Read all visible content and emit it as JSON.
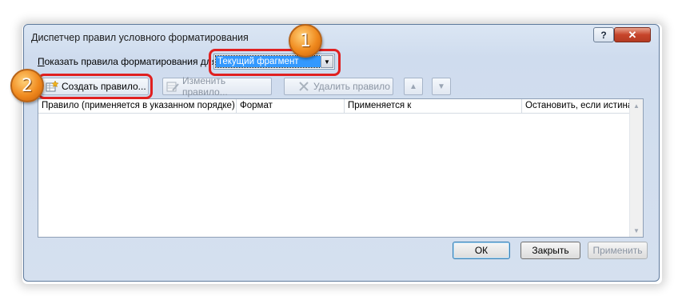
{
  "window": {
    "title": "Диспетчер правил условного форматирования",
    "help_label": "?",
    "close_label": "✕"
  },
  "show_rules": {
    "label_prefix": "П",
    "label_rest": "оказать правила форматирования для:",
    "selected_value": "Текущий фрагмент",
    "arrow": "▼"
  },
  "toolbar": {
    "new_rule": "Создать правило...",
    "edit_rule": "Изменить правило...",
    "delete_rule": "Удалить правило",
    "move_up": "▲",
    "move_down": "▼"
  },
  "table": {
    "columns": [
      "Правило (применяется в указанном порядке)",
      "Формат",
      "Применяется к",
      "Остановить, если истина"
    ],
    "rows": []
  },
  "scrollbar": {
    "up": "▲",
    "down": "▼"
  },
  "footer": {
    "ok": "ОК",
    "close": "Закрыть",
    "apply": "Применить"
  },
  "annotations": {
    "badge_1": "1",
    "badge_2": "2",
    "color": "#e02020"
  }
}
